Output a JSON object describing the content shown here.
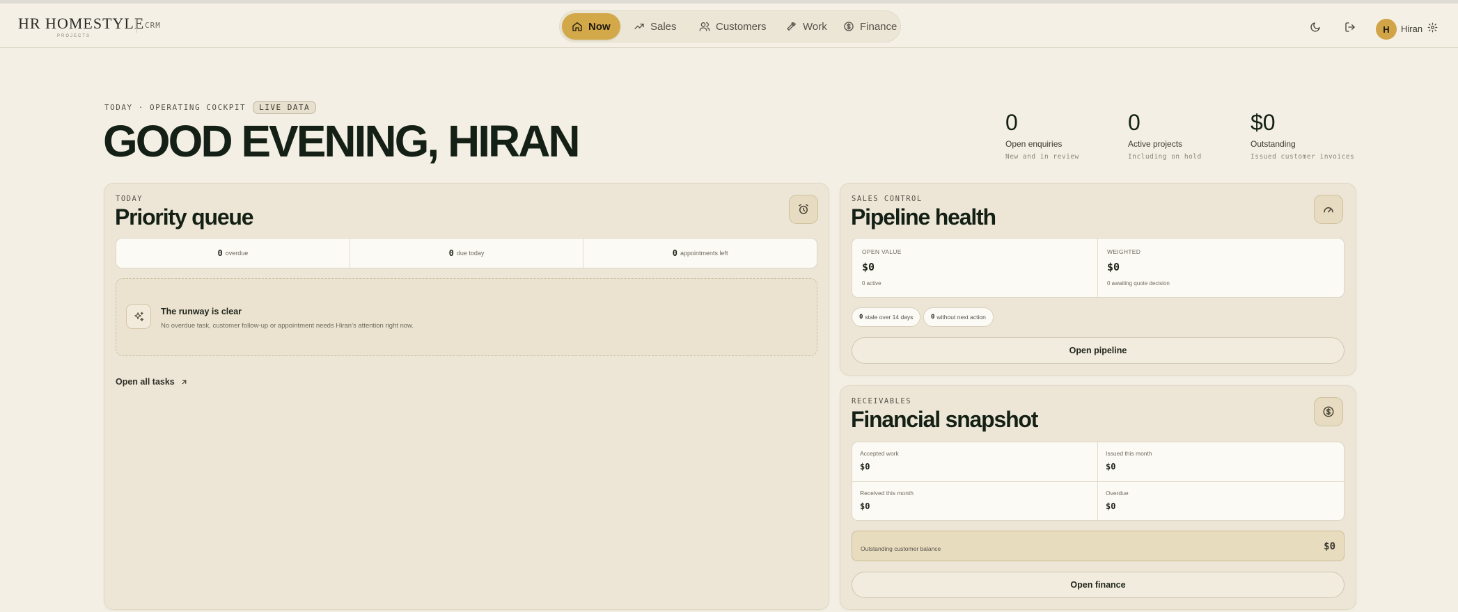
{
  "brand": {
    "name": "HR HOMESTYLE",
    "sub": "PROJECTS",
    "app": "CRM"
  },
  "nav": [
    {
      "label": "Now",
      "icon": "home-icon",
      "active": true
    },
    {
      "label": "Sales",
      "icon": "trending-up-icon"
    },
    {
      "label": "Customers",
      "icon": "users-icon"
    },
    {
      "label": "Work",
      "icon": "hammer-icon"
    },
    {
      "label": "Finance",
      "icon": "dollar-circle-icon"
    }
  ],
  "user": {
    "initial": "H",
    "name": "Hiran"
  },
  "hero": {
    "eyebrow": "TODAY · OPERATING COCKPIT",
    "badge": "LIVE DATA",
    "greeting": "GOOD EVENING, HIRAN"
  },
  "kpis": [
    {
      "value": "0",
      "label": "Open enquiries",
      "sub": "New and in review"
    },
    {
      "value": "0",
      "label": "Active projects",
      "sub": "Including on hold"
    },
    {
      "value": "$0",
      "label": "Outstanding",
      "sub": "Issued customer invoices"
    }
  ],
  "priority": {
    "eyebrow": "TODAY",
    "title": "Priority queue",
    "counters": [
      {
        "n": "0",
        "t": "overdue"
      },
      {
        "n": "0",
        "t": "due today"
      },
      {
        "n": "0",
        "t": "appointments left"
      }
    ],
    "empty_title": "The runway is clear",
    "empty_text": "No overdue task, customer follow-up or appointment needs Hiran’s attention right now.",
    "link": "Open all tasks"
  },
  "pipeline": {
    "eyebrow": "SALES CONTROL",
    "title": "Pipeline health",
    "open_label": "OPEN VALUE",
    "open_value": "$0",
    "open_sub": "0 active",
    "weighted_label": "WEIGHTED",
    "weighted_value": "$0",
    "weighted_sub": "0 awaiting quote decision",
    "chips": [
      {
        "n": "0",
        "t": "stale over 14 days"
      },
      {
        "n": "0",
        "t": "without next action"
      }
    ],
    "button": "Open pipeline"
  },
  "finance": {
    "eyebrow": "RECEIVABLES",
    "title": "Financial snapshot",
    "cells": [
      {
        "label": "Accepted work",
        "value": "$0"
      },
      {
        "label": "Issued this month",
        "value": "$0"
      },
      {
        "label": "Received this month",
        "value": "$0"
      },
      {
        "label": "Overdue",
        "value": "$0"
      }
    ],
    "balance_label": "Outstanding customer balance",
    "balance_value": "$0",
    "button": "Open finance"
  }
}
